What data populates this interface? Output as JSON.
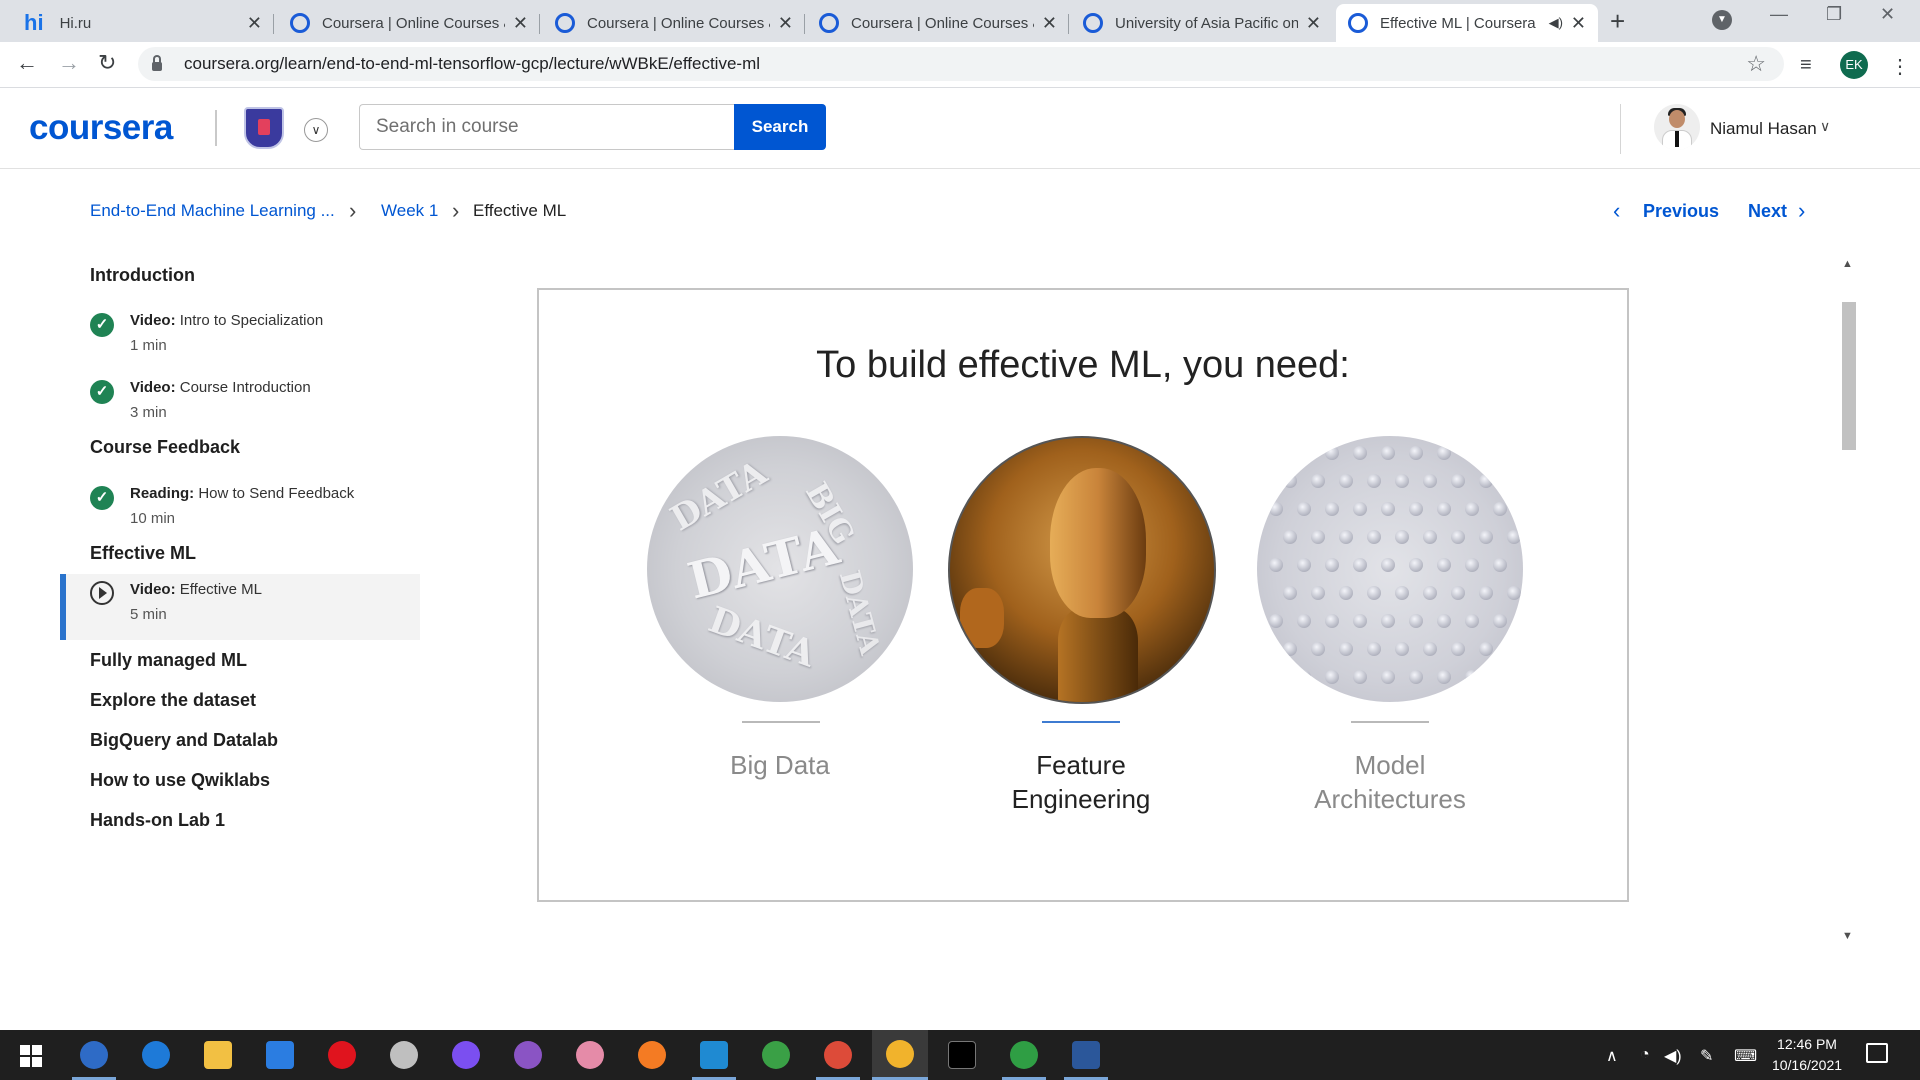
{
  "browser": {
    "tabs": [
      {
        "title": "Hi.ru",
        "favicon": "hi"
      },
      {
        "title": "Coursera | Online Courses & Credentials",
        "favicon": "coursera"
      },
      {
        "title": "Coursera | Online Courses & Credentials",
        "favicon": "coursera"
      },
      {
        "title": "Coursera | Online Courses & Credentials",
        "favicon": "coursera"
      },
      {
        "title": "University of Asia Pacific on Coursera",
        "favicon": "coursera"
      },
      {
        "title": "Effective ML | Coursera",
        "favicon": "coursera",
        "active": true,
        "audio": true
      }
    ],
    "hi_logo": "hi",
    "url": "coursera.org/learn/end-to-end-ml-tensorflow-gcp/lecture/wWBkE/effective-ml",
    "profile_initials": "EK"
  },
  "header": {
    "logo": "coursera",
    "search_placeholder": "Search in course",
    "search_button": "Search",
    "user_name": "Niamul Hasan"
  },
  "breadcrumb": {
    "course": "End-to-End Machine Learning ...",
    "week": "Week 1",
    "current": "Effective ML"
  },
  "lesson_nav": {
    "previous": "Previous",
    "next": "Next"
  },
  "sidebar": {
    "sections": [
      {
        "title": "Introduction",
        "items": [
          {
            "type": "Video:",
            "name": "Intro to Specialization",
            "duration": "1 min",
            "status": "completed"
          },
          {
            "type": "Video:",
            "name": "Course Introduction",
            "duration": "3 min",
            "status": "completed"
          }
        ]
      },
      {
        "title": "Course Feedback",
        "items": [
          {
            "type": "Reading:",
            "name": "How to Send Feedback",
            "duration": "10 min",
            "status": "completed"
          }
        ]
      },
      {
        "title": "Effective ML",
        "items": [
          {
            "type": "Video:",
            "name": "Effective ML",
            "duration": "5 min",
            "status": "current"
          }
        ]
      },
      {
        "title": "Fully managed ML",
        "items": []
      },
      {
        "title": "Explore the dataset",
        "items": []
      },
      {
        "title": "BigQuery and Datalab",
        "items": []
      },
      {
        "title": "How to use Qwiklabs",
        "items": []
      },
      {
        "title": "Hands-on Lab 1",
        "items": []
      }
    ]
  },
  "slide": {
    "title": "To build effective ML, you need:",
    "pillars": [
      {
        "label_line1": "Big Data",
        "label_line2": "",
        "highlighted": false,
        "image": "big-data-letters"
      },
      {
        "label_line1": "Feature",
        "label_line2": "Engineering",
        "highlighted": true,
        "image": "circuit-face"
      },
      {
        "label_line1": "Model",
        "label_line2": "Architectures",
        "highlighted": false,
        "image": "dotted-surface"
      }
    ],
    "image_text": {
      "data": "DATA",
      "big": "BIG"
    }
  },
  "taskbar": {
    "apps": [
      "qbittorrent-icon",
      "edge-icon",
      "file-explorer-icon",
      "mail-icon",
      "opera-icon",
      "satellite-icon",
      "messenger-icon",
      "github-icon",
      "paint-icon",
      "firefox-icon",
      "vscode-icon",
      "globe-icon",
      "chrome-icon",
      "chrome-icon",
      "terminal-icon",
      "chrome-profile-icon",
      "word-icon"
    ],
    "time": "12:46 PM",
    "date": "10/16/2021"
  },
  "colors": {
    "brand": "#0056d2",
    "completed": "#1f8354",
    "active_marker": "#2a73cc"
  }
}
